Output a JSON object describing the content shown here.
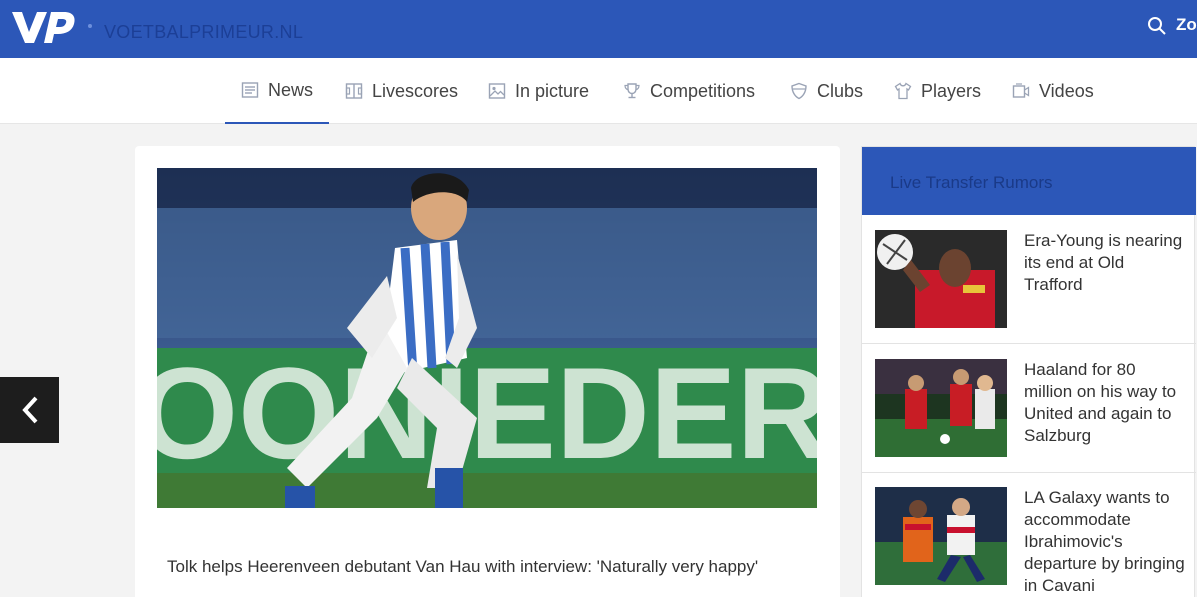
{
  "header": {
    "logo_text": "VP",
    "site_name": "VOETBALPRIMEUR.NL",
    "search_label": "Zo"
  },
  "nav": {
    "items": [
      {
        "label": "News",
        "icon": "news-icon"
      },
      {
        "label": "Livescores",
        "icon": "livescores-icon"
      },
      {
        "label": "In picture",
        "icon": "picture-icon"
      },
      {
        "label": "Competitions",
        "icon": "trophy-icon"
      },
      {
        "label": "Clubs",
        "icon": "shield-icon"
      },
      {
        "label": "Players",
        "icon": "shirt-icon"
      },
      {
        "label": "Videos",
        "icon": "video-icon"
      }
    ],
    "active": "News"
  },
  "article": {
    "caption": "Tolk helps Heerenveen debutant Van Hau with interview: 'Naturally very happy'",
    "hero_banner_text": "OONIEDER"
  },
  "sidebar": {
    "title": "Live Transfer Rumors",
    "rumors": [
      {
        "title": "Era-Young is nearing its end at Old Trafford"
      },
      {
        "title": "Haaland for 80 million on his way to United and again to Salzburg"
      },
      {
        "title": "LA Galaxy wants to accommodate Ibrahimovic's departure by bringing in Cavani"
      }
    ]
  },
  "colors": {
    "brand_blue": "#2c57b8",
    "dark_button": "#1d1d1d"
  }
}
